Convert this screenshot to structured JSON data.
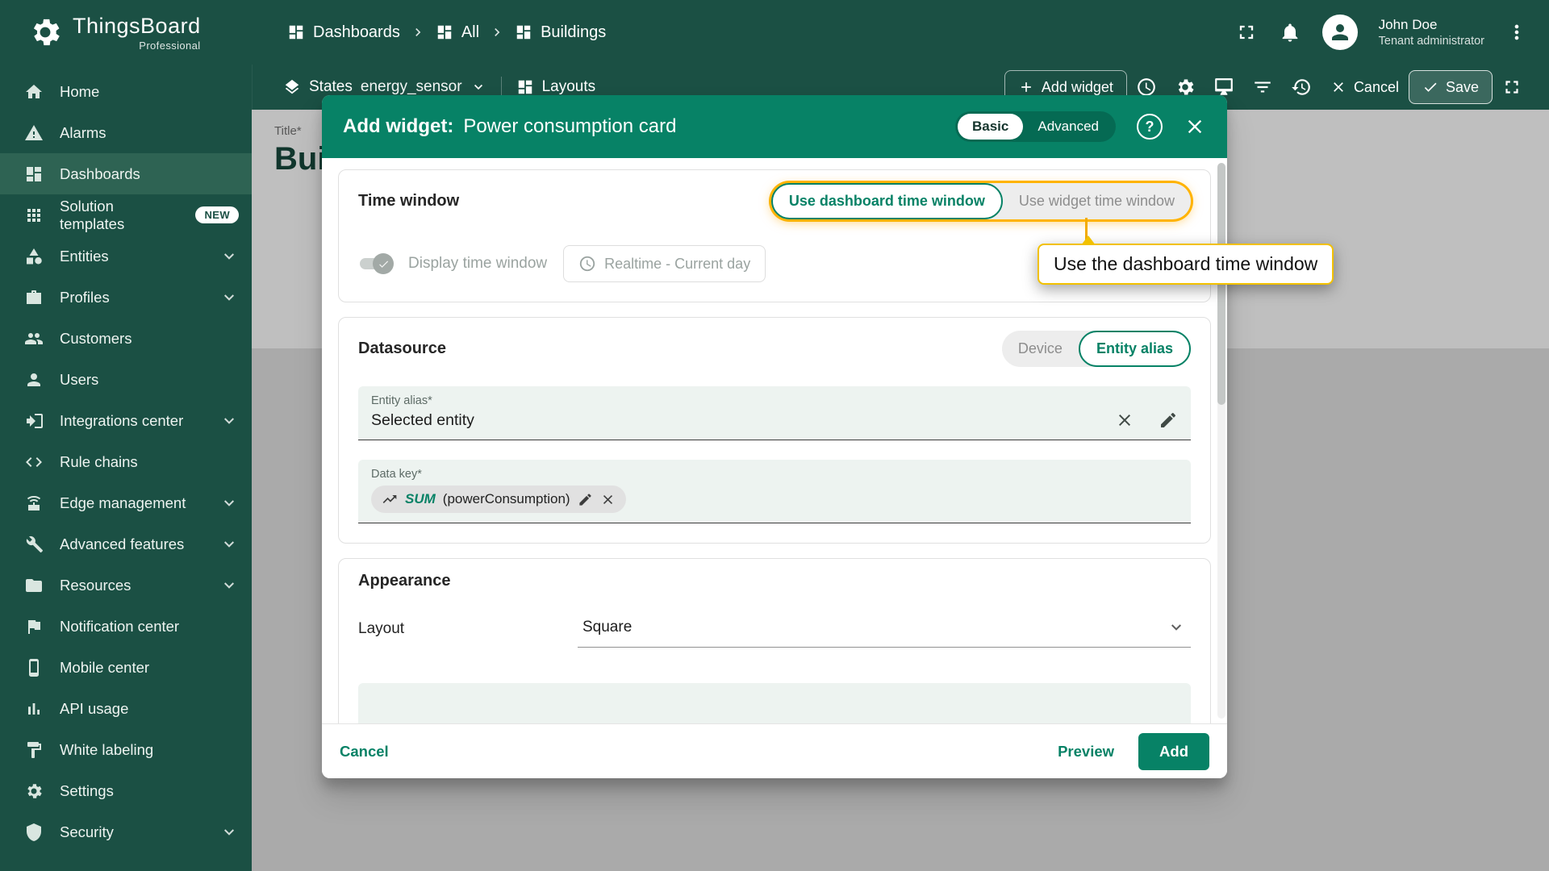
{
  "colors": {
    "brand_dark": "#1b5044",
    "teal": "#078266",
    "highlight": "#ffb300"
  },
  "app": {
    "name": "ThingsBoard",
    "edition": "Professional"
  },
  "topbar": {
    "breadcrumb": [
      {
        "label": "Dashboards"
      },
      {
        "label": "All"
      },
      {
        "label": "Buildings"
      }
    ],
    "user": {
      "name": "John Doe",
      "role": "Tenant administrator"
    }
  },
  "sidebar": {
    "items": [
      {
        "label": "Home"
      },
      {
        "label": "Alarms"
      },
      {
        "label": "Dashboards"
      },
      {
        "label": "Solution templates",
        "badge": "NEW"
      },
      {
        "label": "Entities"
      },
      {
        "label": "Profiles"
      },
      {
        "label": "Customers"
      },
      {
        "label": "Users"
      },
      {
        "label": "Integrations center"
      },
      {
        "label": "Rule chains"
      },
      {
        "label": "Edge management"
      },
      {
        "label": "Advanced features"
      },
      {
        "label": "Resources"
      },
      {
        "label": "Notification center"
      },
      {
        "label": "Mobile center"
      },
      {
        "label": "API usage"
      },
      {
        "label": "White labeling"
      },
      {
        "label": "Settings"
      },
      {
        "label": "Security"
      }
    ]
  },
  "toolbar": {
    "states_label": "States",
    "states_value": "energy_sensor",
    "layouts_label": "Layouts",
    "add_widget": "Add widget",
    "cancel": "Cancel",
    "save": "Save"
  },
  "page": {
    "title_label": "Title*",
    "title_value": "Bui"
  },
  "dialog": {
    "title_prefix": "Add widget:",
    "title_name": "Power consumption card",
    "help": "?",
    "modes": {
      "basic": "Basic",
      "advanced": "Advanced"
    },
    "time_window": {
      "title": "Time window",
      "dashboard_option": "Use dashboard time window",
      "widget_option": "Use widget time window",
      "display_label": "Display time window",
      "realtime": "Realtime - Current day"
    },
    "tooltip": "Use the dashboard time window",
    "datasource": {
      "title": "Datasource",
      "device_option": "Device",
      "entity_option": "Entity alias",
      "entity_alias_label": "Entity alias*",
      "entity_alias_value": "Selected entity",
      "data_key_label": "Data key*",
      "key_fn": "SUM",
      "key_arg": "(powerConsumption)"
    },
    "appearance": {
      "title": "Appearance",
      "layout_label": "Layout",
      "layout_value": "Square"
    },
    "footer": {
      "cancel": "Cancel",
      "preview": "Preview",
      "add": "Add"
    }
  }
}
